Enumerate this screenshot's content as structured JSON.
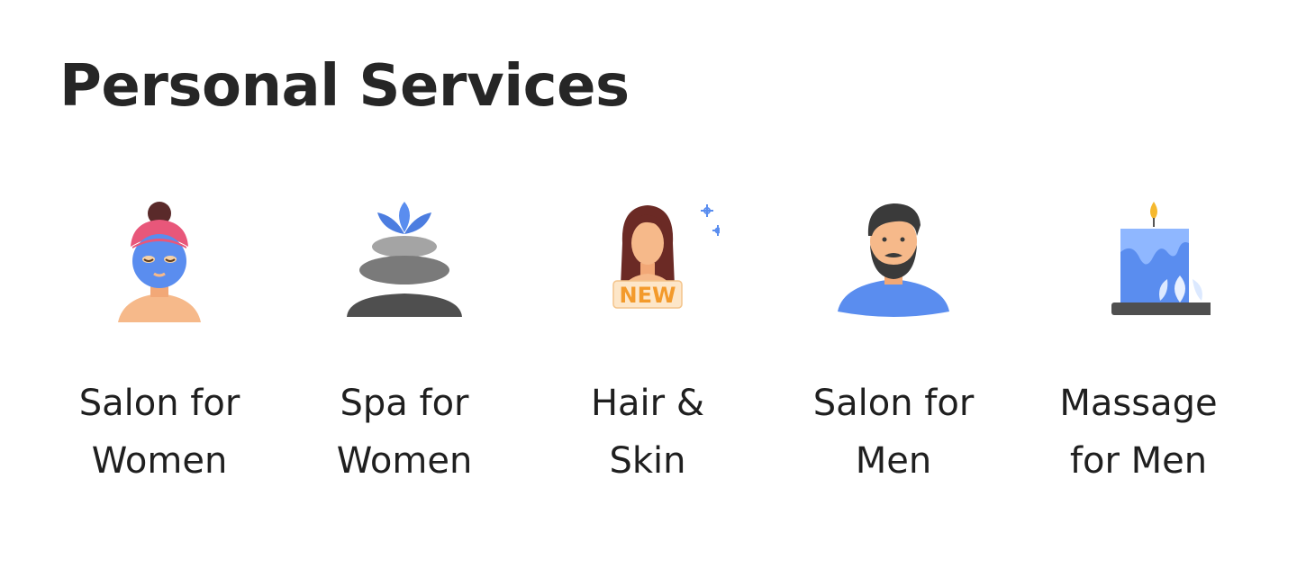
{
  "section": {
    "title": "Personal Services"
  },
  "services": [
    {
      "icon": "face-mask-woman-icon",
      "line1": "Salon for",
      "line2": "Women"
    },
    {
      "icon": "spa-stones-lotus-icon",
      "line1": "Spa for",
      "line2": "Women"
    },
    {
      "icon": "new-hair-skin-icon",
      "badge": "NEW",
      "line1": "Hair &",
      "line2": "Skin"
    },
    {
      "icon": "bearded-man-icon",
      "line1": "Salon for",
      "line2": "Men"
    },
    {
      "icon": "candle-lotus-icon",
      "line1": "Massage",
      "line2": "for Men"
    }
  ],
  "colors": {
    "title": "#262626",
    "text": "#1f1f1f",
    "accent_blue": "#5a8def",
    "skin": "#f6b98a",
    "pink": "#e8577a",
    "stone_dark": "#4f4f4f",
    "stone_mid": "#7a7a7a",
    "stone_light": "#a4a4a4",
    "badge_bg": "#fde6c8",
    "badge_text": "#f39a2b",
    "flame": "#f5b82e"
  }
}
